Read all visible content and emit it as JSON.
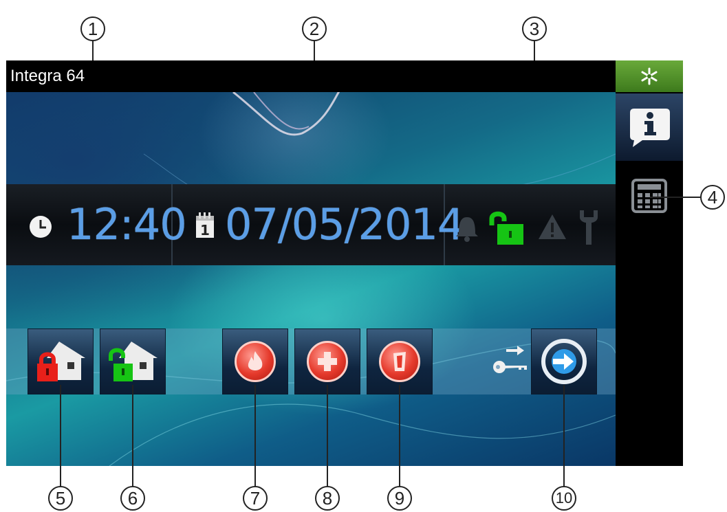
{
  "window": {
    "title": "Integra 64"
  },
  "status": {
    "time": "12:40",
    "date": "07/05/2014",
    "calendar_day": "1"
  },
  "callouts": [
    "1",
    "2",
    "3",
    "4",
    "5",
    "6",
    "7",
    "8",
    "9",
    "10"
  ],
  "colors": {
    "time_text": "#5b9ee6",
    "unlock_green": "#16c414",
    "lock_red": "#e8201a",
    "alarm_red": "#e53a2c",
    "snow_button": "#5a9a2e"
  },
  "icons": {
    "snow_button": "snowflake-icon",
    "info_button": "info-icon",
    "keyboard_button": "keypad-icon",
    "clock": "clock-icon",
    "calendar": "calendar-icon",
    "alarm_bell": "bell-icon",
    "lock": "open-padlock-icon",
    "trouble": "warning-icon",
    "service": "wrench-icon",
    "arm": "house-locked-icon",
    "disarm": "house-unlocked-icon",
    "fire": "fire-icon",
    "medical": "medical-cross-icon",
    "panic": "panic-icon",
    "key_arrow": "key-arrow-icon",
    "exit": "exit-arrow-icon"
  }
}
